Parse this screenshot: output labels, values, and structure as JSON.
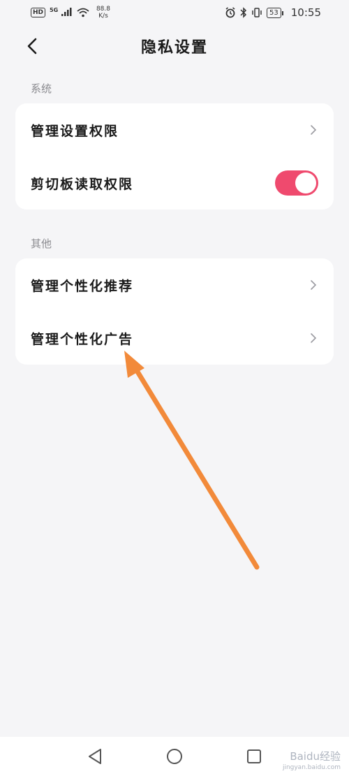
{
  "status_bar": {
    "hd": "HD",
    "signal_label": "5G",
    "net_speed_value": "88.8",
    "net_speed_unit": "K/s",
    "battery": "53",
    "time": "10:55"
  },
  "header": {
    "title": "隐私设置"
  },
  "sections": {
    "system": {
      "label": "系统",
      "items": [
        {
          "label": "管理设置权限"
        },
        {
          "label": "剪切板读取权限",
          "toggle_on": true
        }
      ]
    },
    "other": {
      "label": "其他",
      "items": [
        {
          "label": "管理个性化推荐"
        },
        {
          "label": "管理个性化广告"
        }
      ]
    }
  },
  "colors": {
    "accent": "#ef4a6e",
    "annotation_arrow": "#f28a3a",
    "background": "#f5f5f7"
  },
  "watermark": {
    "brand": "Baidu经验",
    "url": "jingyan.baidu.com"
  }
}
